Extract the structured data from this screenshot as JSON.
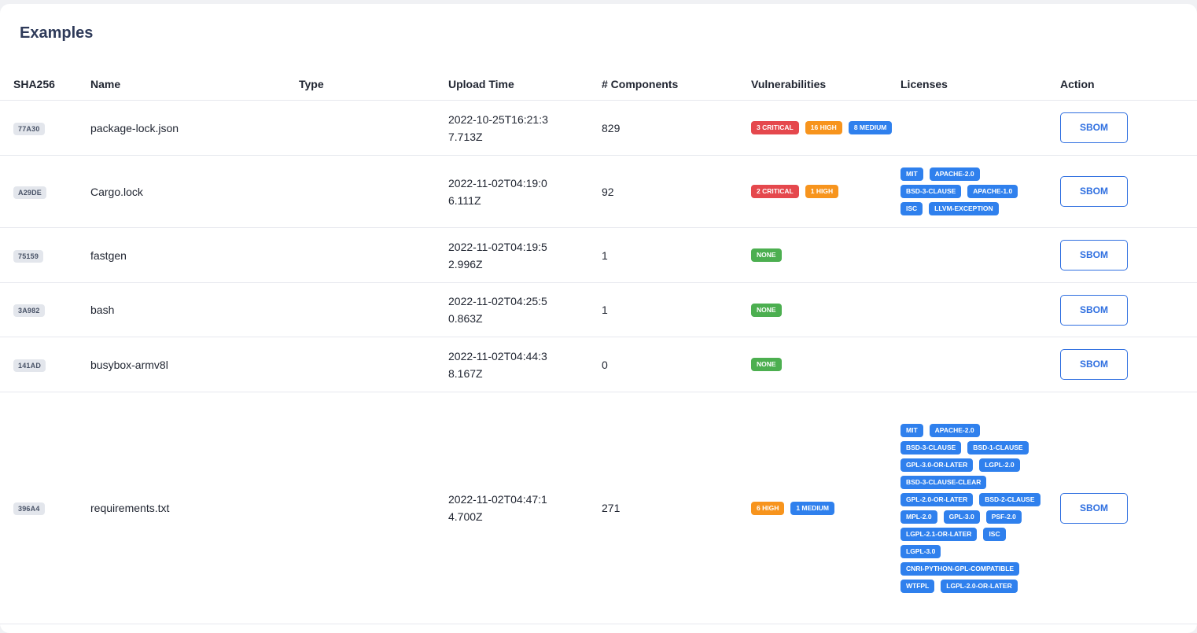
{
  "page": {
    "title": "Examples"
  },
  "colors": {
    "critical": "#e5484d",
    "high": "#f7941d",
    "medium": "#2f80ed",
    "none": "#4caf50",
    "license": "#2f80ed"
  },
  "table": {
    "headers": {
      "sha": "SHA256",
      "name": "Name",
      "type": "Type",
      "upload_time": "Upload Time",
      "components": "# Components",
      "vulnerabilities": "Vulnerabilities",
      "licenses": "Licenses",
      "action": "Action"
    },
    "rows": [
      {
        "sha": "77A30",
        "name": "package-lock.json",
        "type": "",
        "upload_time": "2022-10-25T16:21:37.713Z",
        "components": "829",
        "vulnerabilities": [
          {
            "label": "3 CRITICAL",
            "level": "critical"
          },
          {
            "label": "16 HIGH",
            "level": "high"
          },
          {
            "label": "8 MEDIUM",
            "level": "medium"
          }
        ],
        "licenses": [],
        "action": "SBOM",
        "height": 70
      },
      {
        "sha": "A29DE",
        "name": "Cargo.lock",
        "type": "",
        "upload_time": "2022-11-02T04:19:06.111Z",
        "components": "92",
        "vulnerabilities": [
          {
            "label": "2 CRITICAL",
            "level": "critical"
          },
          {
            "label": "1 HIGH",
            "level": "high"
          }
        ],
        "licenses": [
          "MIT",
          "APACHE-2.0",
          "BSD-3-CLAUSE",
          "APACHE-1.0",
          "ISC",
          "LLVM-EXCEPTION"
        ],
        "action": "SBOM",
        "height": 92
      },
      {
        "sha": "75159",
        "name": "fastgen",
        "type": "",
        "upload_time": "2022-11-02T04:19:52.996Z",
        "components": "1",
        "vulnerabilities": [
          {
            "label": "NONE",
            "level": "none"
          }
        ],
        "licenses": [],
        "action": "SBOM",
        "height": 70
      },
      {
        "sha": "3A982",
        "name": "bash",
        "type": "",
        "upload_time": "2022-11-02T04:25:50.863Z",
        "components": "1",
        "vulnerabilities": [
          {
            "label": "NONE",
            "level": "none"
          }
        ],
        "licenses": [],
        "action": "SBOM",
        "height": 69
      },
      {
        "sha": "141AD",
        "name": "busybox-armv8l",
        "type": "",
        "upload_time": "2022-11-02T04:44:38.167Z",
        "components": "0",
        "vulnerabilities": [
          {
            "label": "NONE",
            "level": "none"
          }
        ],
        "licenses": [],
        "action": "SBOM",
        "height": 70
      },
      {
        "sha": "396A4",
        "name": "requirements.txt",
        "type": "",
        "upload_time": "2022-11-02T04:47:14.700Z",
        "components": "271",
        "vulnerabilities": [
          {
            "label": "6 HIGH",
            "level": "high"
          },
          {
            "label": "1 MEDIUM",
            "level": "medium"
          }
        ],
        "licenses": [
          "MIT",
          "APACHE-2.0",
          "BSD-3-CLAUSE",
          "BSD-1-CLAUSE",
          "GPL-3.0-OR-LATER",
          "LGPL-2.0",
          "BSD-3-CLAUSE-CLEAR",
          "GPL-2.0-OR-LATER",
          "BSD-2-CLAUSE",
          "MPL-2.0",
          "GPL-3.0",
          "PSF-2.0",
          "LGPL-2.1-OR-LATER",
          "ISC",
          "LGPL-3.0",
          "CNRI-PYTHON-GPL-COMPATIBLE",
          "WTFPL",
          "LGPL-2.0-OR-LATER"
        ],
        "action": "SBOM",
        "height": 295
      }
    ]
  }
}
